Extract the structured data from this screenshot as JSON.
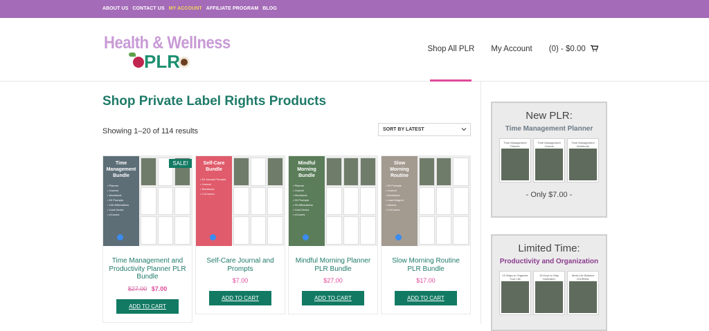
{
  "topbar": {
    "links": [
      {
        "label": "ABOUT US"
      },
      {
        "label": "CONTACT US"
      },
      {
        "label": "MY ACCOUNT",
        "active": true
      },
      {
        "label": "AFFILIATE PROGRAM"
      },
      {
        "label": "BLOG"
      }
    ],
    "bg_color": "#a46bb8"
  },
  "logo": {
    "line1": "Health & Wellness",
    "line2": "PLR"
  },
  "nav": {
    "shop_all": "Shop All PLR",
    "my_account": "My Account",
    "cart": "(0) - $0.00",
    "cart_icon": "shopping-cart-icon"
  },
  "main": {
    "title": "Shop Private Label Rights Products",
    "results": "Showing 1–20 of 114 results",
    "sort_value": "SORT BY LATEST",
    "accent": "#1e7a68",
    "price_color": "#e0499a"
  },
  "products": [
    {
      "title": "Time Management and Productivity Planner PLR Bundle",
      "old_price": "$27.00",
      "price": "$7.00",
      "sale_label": "SALE!",
      "button": "ADD TO CART",
      "thumb": {
        "heading": "Time Management Bundle",
        "color": "#5d6e77",
        "items": [
          "Planner",
          "Journal",
          "Workbook",
          "50 Prompts",
          "100 Affirmations",
          "Card Decks",
          "eCovers"
        ]
      }
    },
    {
      "title": "Self-Care Journal and Prompts",
      "price": "$7.00",
      "button": "ADD TO CART",
      "thumb": {
        "heading": "Self-Care Bundle",
        "color": "#e05b6b",
        "items": [
          "50 Journal Prompts",
          "Journal",
          "Workbook",
          "2 eCovers"
        ]
      }
    },
    {
      "title": "Mindful Morning Planner PLR Bundle",
      "price": "$27.00",
      "button": "ADD TO CART",
      "thumb": {
        "heading": "Mindful Morning Bundle",
        "color": "#5b7d5a",
        "items": [
          "Planner",
          "Journal",
          "Workbook",
          "90 Prompts",
          "90 Affirmations",
          "Card Decks",
          "eCovers"
        ]
      }
    },
    {
      "title": "Slow Morning Routine PLR Bundle",
      "price": "$17.00",
      "button": "ADD TO CART",
      "thumb": {
        "heading": "Slow Morning Routine",
        "color": "#a39a90",
        "items": [
          "50 Prompts",
          "Journal",
          "Workbook",
          "Lead Magnet",
          "Articles",
          "3 eCovers"
        ]
      }
    }
  ],
  "sidebar": {
    "promo1": {
      "heading": "New PLR:",
      "subheading": "Time Management Planner",
      "sub_color": "#6b7a86",
      "pics": [
        "Time Management Planner",
        "Time Management Journal",
        "Time Management Workbook"
      ],
      "price_text": "- Only $7.00 -"
    },
    "promo2": {
      "heading": "Limited Time:",
      "subheading": "Productivity and Organization",
      "sub_color": "#8a3c8e",
      "pics": [
        "15 Ways to Organize Your Life",
        "15 Keys to Stay Motivated",
        "Work-Life Balance JOURNAL"
      ]
    }
  }
}
